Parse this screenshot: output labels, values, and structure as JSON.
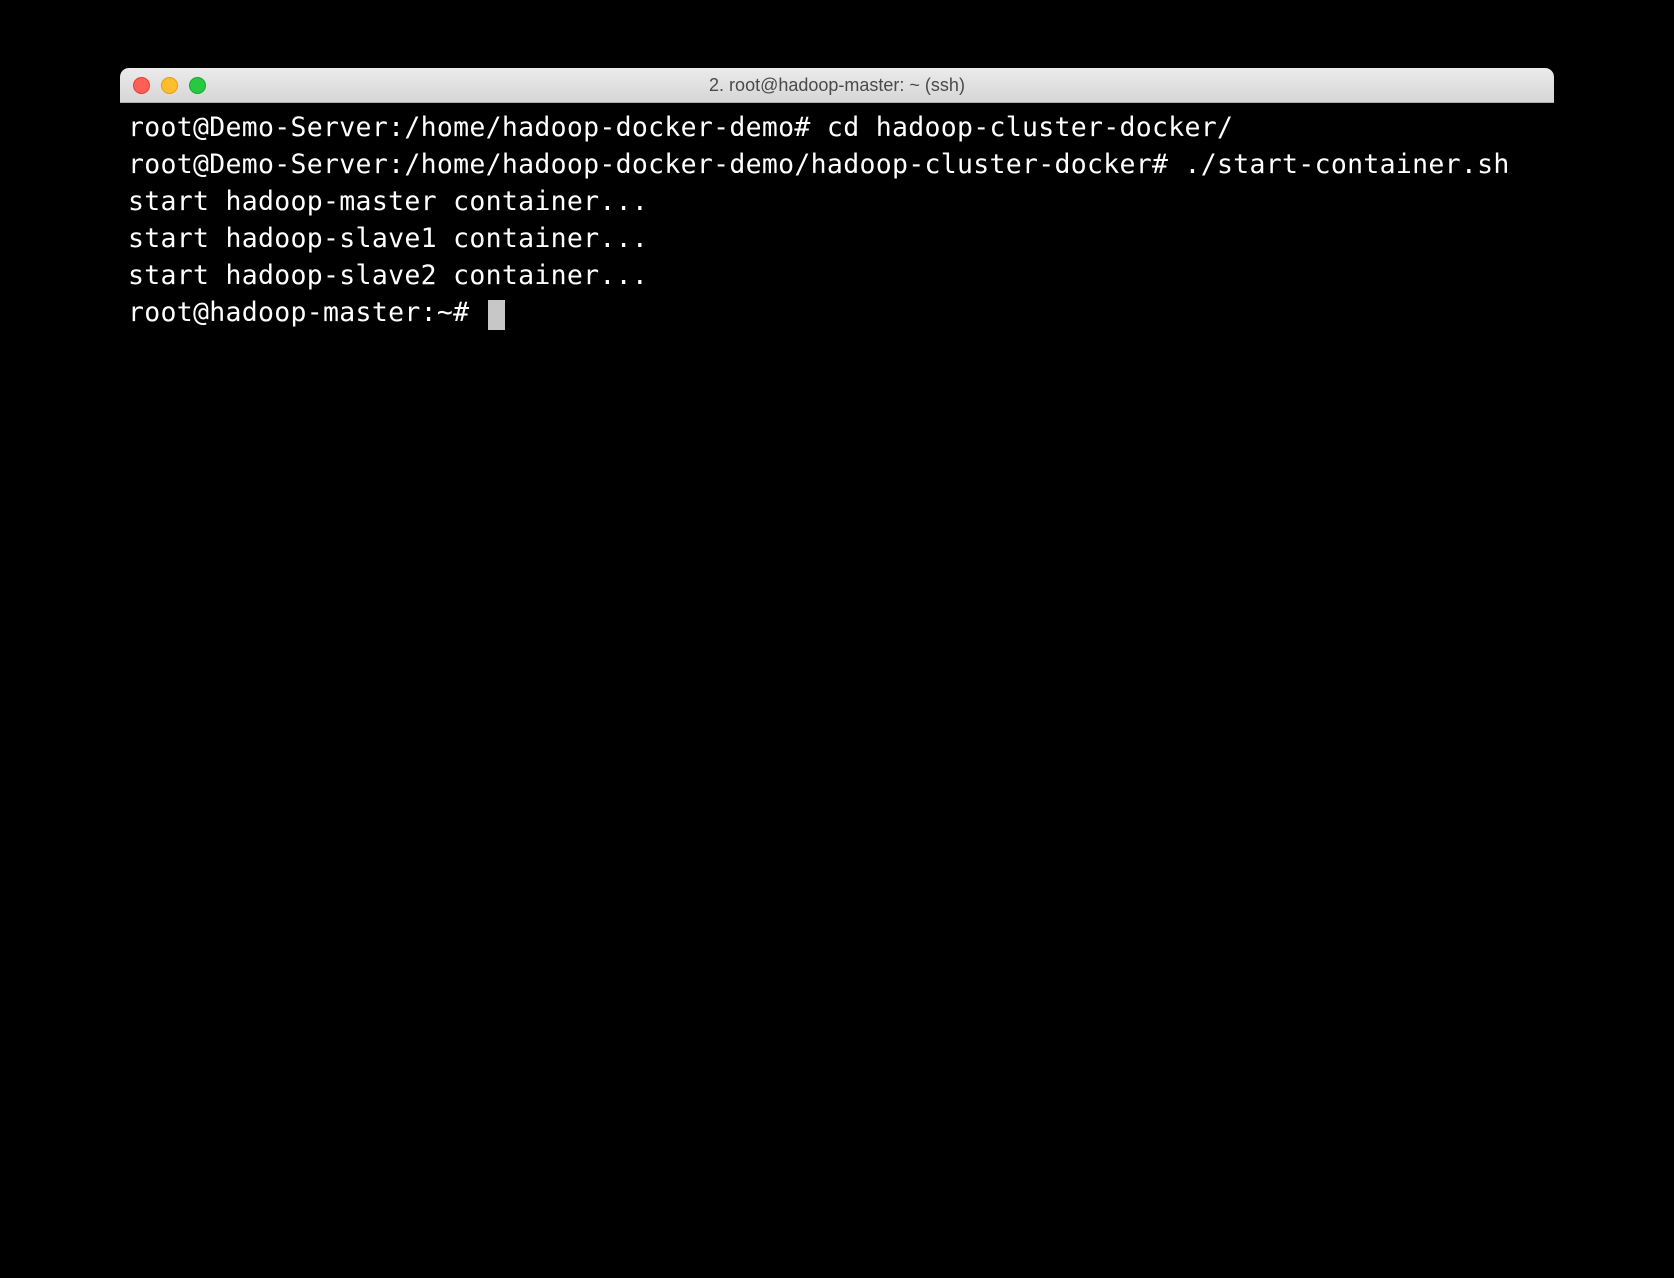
{
  "window": {
    "title": "2. root@hadoop-master: ~ (ssh)"
  },
  "terminal": {
    "lines": [
      "root@Demo-Server:/home/hadoop-docker-demo# cd hadoop-cluster-docker/",
      "root@Demo-Server:/home/hadoop-docker-demo/hadoop-cluster-docker# ./start-container.sh",
      "start hadoop-master container...",
      "start hadoop-slave1 container...",
      "start hadoop-slave2 container..."
    ],
    "current_prompt": "root@hadoop-master:~# "
  }
}
